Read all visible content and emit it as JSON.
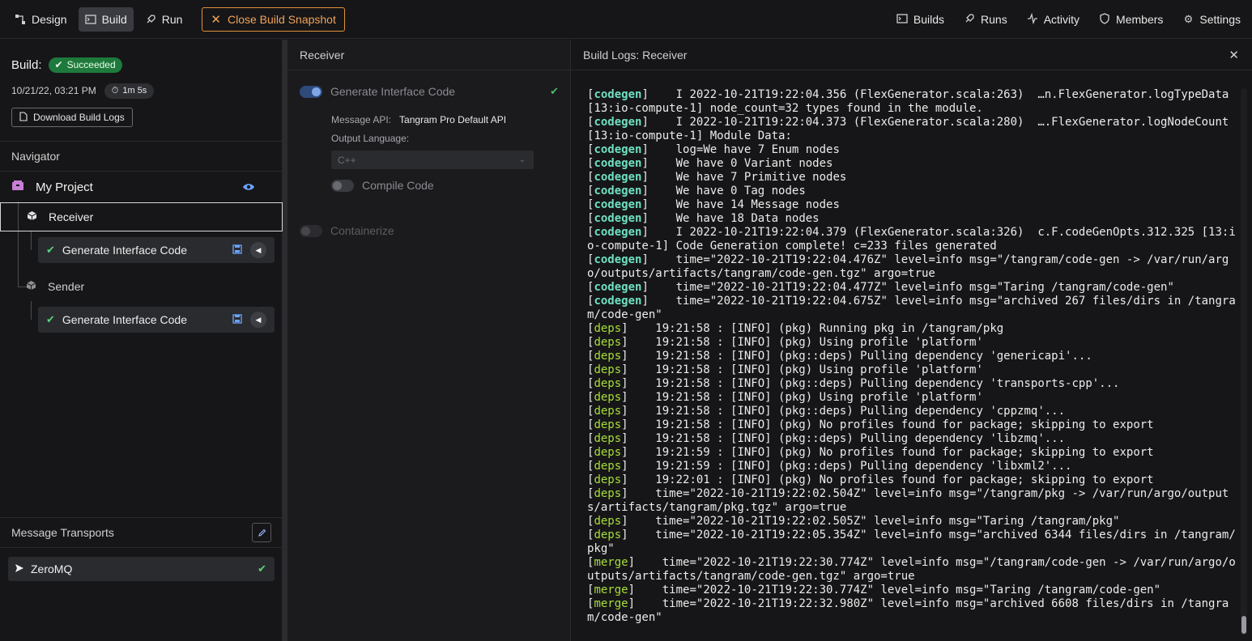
{
  "topbar": {
    "design": "Design",
    "build": "Build",
    "run": "Run",
    "close_snapshot": "Close Build Snapshot",
    "right": [
      "Builds",
      "Runs",
      "Activity",
      "Members",
      "Settings"
    ]
  },
  "build": {
    "label": "Build:",
    "status": "Succeeded",
    "datetime": "10/21/22, 03:21 PM",
    "duration": "1m 5s",
    "download": "Download Build Logs"
  },
  "navigator": {
    "title": "Navigator",
    "project": "My Project",
    "nodes": [
      {
        "name": "Receiver",
        "step": "Generate Interface Code"
      },
      {
        "name": "Sender",
        "step": "Generate Interface Code"
      }
    ]
  },
  "transports": {
    "title": "Message Transports",
    "items": [
      "ZeroMQ"
    ]
  },
  "middle": {
    "title": "Receiver",
    "generate": "Generate Interface Code",
    "message_api_label": "Message API:",
    "message_api_value": "Tangram Pro Default API",
    "output_language_label": "Output Language:",
    "output_language_value": "C++",
    "compile": "Compile Code",
    "containerize": "Containerize"
  },
  "logs": {
    "title": "Build Logs: Receiver",
    "lines": [
      {
        "tag": "codegen",
        "text": "    I 2022-10-21T19:22:04.356 (FlexGenerator.scala:263)  …n.FlexGenerator.logTypeData [13:io-compute-1] node_count=32 types found in the module."
      },
      {
        "tag": "codegen",
        "text": "    I 2022-10-21T19:22:04.373 (FlexGenerator.scala:280)  ….FlexGenerator.logNodeCount [13:io-compute-1] Module Data:"
      },
      {
        "tag": "codegen",
        "text": "    log=We have 7 Enum nodes"
      },
      {
        "tag": "codegen",
        "text": "    We have 0 Variant nodes"
      },
      {
        "tag": "codegen",
        "text": "    We have 7 Primitive nodes"
      },
      {
        "tag": "codegen",
        "text": "    We have 0 Tag nodes"
      },
      {
        "tag": "codegen",
        "text": "    We have 14 Message nodes"
      },
      {
        "tag": "codegen",
        "text": "    We have 18 Data nodes"
      },
      {
        "tag": "codegen",
        "text": "    I 2022-10-21T19:22:04.379 (FlexGenerator.scala:326)  c.F.codeGenOpts.312.325 [13:io-compute-1] Code Generation complete! c=233 files generated"
      },
      {
        "tag": "codegen",
        "text": "    time=\"2022-10-21T19:22:04.476Z\" level=info msg=\"/tangram/code-gen -> /var/run/argo/outputs/artifacts/tangram/code-gen.tgz\" argo=true"
      },
      {
        "tag": "codegen",
        "text": "    time=\"2022-10-21T19:22:04.477Z\" level=info msg=\"Taring /tangram/code-gen\""
      },
      {
        "tag": "codegen",
        "text": "    time=\"2022-10-21T19:22:04.675Z\" level=info msg=\"archived 267 files/dirs in /tangram/code-gen\""
      },
      {
        "tag": "deps",
        "text": "    19:21:58 : [INFO] (pkg) Running pkg in /tangram/pkg"
      },
      {
        "tag": "deps",
        "text": "    19:21:58 : [INFO] (pkg) Using profile 'platform'"
      },
      {
        "tag": "deps",
        "text": "    19:21:58 : [INFO] (pkg::deps) Pulling dependency 'genericapi'..."
      },
      {
        "tag": "deps",
        "text": "    19:21:58 : [INFO] (pkg) Using profile 'platform'"
      },
      {
        "tag": "deps",
        "text": "    19:21:58 : [INFO] (pkg::deps) Pulling dependency 'transports-cpp'..."
      },
      {
        "tag": "deps",
        "text": "    19:21:58 : [INFO] (pkg) Using profile 'platform'"
      },
      {
        "tag": "deps",
        "text": "    19:21:58 : [INFO] (pkg::deps) Pulling dependency 'cppzmq'..."
      },
      {
        "tag": "deps",
        "text": "    19:21:58 : [INFO] (pkg) No profiles found for package; skipping to export"
      },
      {
        "tag": "deps",
        "text": "    19:21:58 : [INFO] (pkg::deps) Pulling dependency 'libzmq'..."
      },
      {
        "tag": "deps",
        "text": "    19:21:59 : [INFO] (pkg) No profiles found for package; skipping to export"
      },
      {
        "tag": "deps",
        "text": "    19:21:59 : [INFO] (pkg::deps) Pulling dependency 'libxml2'..."
      },
      {
        "tag": "deps",
        "text": "    19:22:01 : [INFO] (pkg) No profiles found for package; skipping to export"
      },
      {
        "tag": "deps",
        "text": "    time=\"2022-10-21T19:22:02.504Z\" level=info msg=\"/tangram/pkg -> /var/run/argo/outputs/artifacts/tangram/pkg.tgz\" argo=true"
      },
      {
        "tag": "deps",
        "text": "    time=\"2022-10-21T19:22:02.505Z\" level=info msg=\"Taring /tangram/pkg\""
      },
      {
        "tag": "deps",
        "text": "    time=\"2022-10-21T19:22:05.354Z\" level=info msg=\"archived 6344 files/dirs in /tangram/pkg\""
      },
      {
        "tag": "merge",
        "text": "    time=\"2022-10-21T19:22:30.774Z\" level=info msg=\"/tangram/code-gen -> /var/run/argo/outputs/artifacts/tangram/code-gen.tgz\" argo=true"
      },
      {
        "tag": "merge",
        "text": "    time=\"2022-10-21T19:22:30.774Z\" level=info msg=\"Taring /tangram/code-gen\""
      },
      {
        "tag": "merge",
        "text": "    time=\"2022-10-21T19:22:32.980Z\" level=info msg=\"archived 6608 files/dirs in /tangram/code-gen\""
      }
    ]
  }
}
